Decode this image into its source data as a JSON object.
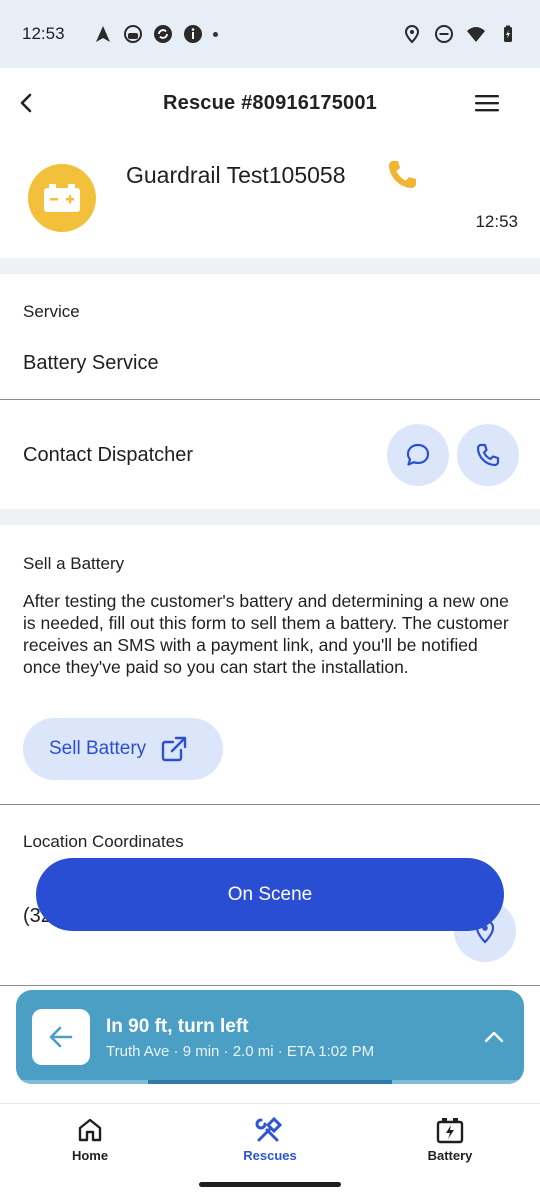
{
  "status_bar": {
    "time": "12:53",
    "left_icons": [
      "navigation-arrow-icon",
      "android-icon",
      "sync-icon",
      "info-icon",
      "dot-icon"
    ],
    "right_icons": [
      "location-pin-icon",
      "do-not-disturb-icon",
      "wifi-icon",
      "battery-icon"
    ]
  },
  "header": {
    "title": "Rescue #80916175001"
  },
  "customer": {
    "name": "Guardrail Test105058",
    "time": "12:53",
    "avatar_color": "#f2c03b"
  },
  "service": {
    "label": "Service",
    "value": "Battery Service"
  },
  "dispatcher": {
    "label": "Contact Dispatcher"
  },
  "sell": {
    "label": "Sell a Battery",
    "description": "After testing the customer's battery and determining a new one is needed, fill out this form to sell them a battery. The customer receives an SMS with a payment link, and you'll be notified once they've paid so you can start the installation.",
    "button_label": "Sell Battery"
  },
  "location": {
    "label": "Location Coordinates",
    "value_partial": "(32"
  },
  "on_scene": {
    "label": "On Scene"
  },
  "navigation": {
    "instruction": "In 90 ft, turn left",
    "details": "Truth Ave  ·  9 min  ·  2.0 mi  ·  ETA 1:02 PM",
    "progress": 0.74
  },
  "bottom_nav": {
    "tabs": [
      {
        "label": "Home",
        "icon": "home-icon",
        "active": false
      },
      {
        "label": "Rescues",
        "icon": "tools-icon",
        "active": true
      },
      {
        "label": "Battery",
        "icon": "battery-box-icon",
        "active": false
      }
    ]
  },
  "colors": {
    "primary": "#2a4ed3",
    "accent_bg": "#dce6fa",
    "nav_banner": "#4b9fc5",
    "active_tab": "#2d55d6"
  }
}
